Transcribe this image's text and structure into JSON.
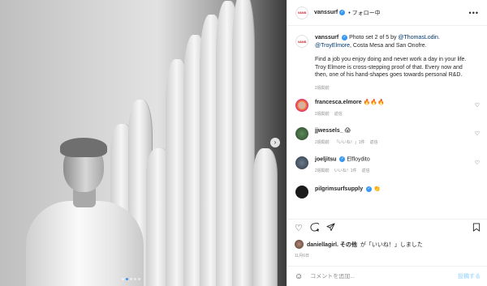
{
  "post": {
    "account": "vanssurf",
    "logo_text": "VANS",
    "follow_label": "• フォロー中",
    "more_label": "•••",
    "caption": {
      "intro": "Photo set 2 of 5 by ",
      "photographer": "@ThomasLodin",
      "sep": ".",
      "subject": "@TroyElmore",
      "location": ", Costa Mesa and San Onofre.",
      "body": "Find a job you enjoy doing and never work a day in your life. Troy Elmore is cross-stepping proof of that. Every now and then, one of his hand-shapes goes towards personal R&D.",
      "time": "2週間前"
    },
    "carousel": {
      "dot_count": 5,
      "active_index": 1,
      "next_label": "›"
    }
  },
  "comments": [
    {
      "user": "francesca.elmore",
      "text": "🔥🔥🔥",
      "time": "2週間前",
      "likes": "",
      "reply": "返信",
      "verified": false
    },
    {
      "user": "jjwessels_",
      "text": "😱",
      "time": "2週間前",
      "likes": "「いいね！」1件",
      "reply": "返信",
      "verified": false
    },
    {
      "user": "joeljitsu",
      "text": "Elfloydito",
      "time": "2週間前",
      "likes": "",
      "reply": "返信",
      "verified": true
    },
    {
      "user": "joeljitsu",
      "text": "Elfloydito",
      "time": "2週間前",
      "likes": "いいね！1件",
      "reply": "返信",
      "verified": false
    },
    {
      "user": "pilgrimsurfsupply",
      "text": "👏",
      "time": "2週間前",
      "likes": "",
      "reply": "",
      "verified": true
    }
  ],
  "likes_line": {
    "user": "daniellagirl.",
    "mid": " その他",
    "suffix": "が「いいね！」しました"
  },
  "date": "11月6日",
  "add_comment": {
    "placeholder": "コメントを追加...",
    "post_label": "投稿する"
  },
  "icons": {
    "heart": "heart-icon",
    "comment": "comment-icon",
    "share": "share-icon",
    "bookmark": "bookmark-icon",
    "emoji": "emoji-icon"
  },
  "colors": {
    "accent": "#3897f0",
    "muted": "#8e8e8e",
    "link": "#00376b",
    "post_disabled": "#b2dffc"
  }
}
